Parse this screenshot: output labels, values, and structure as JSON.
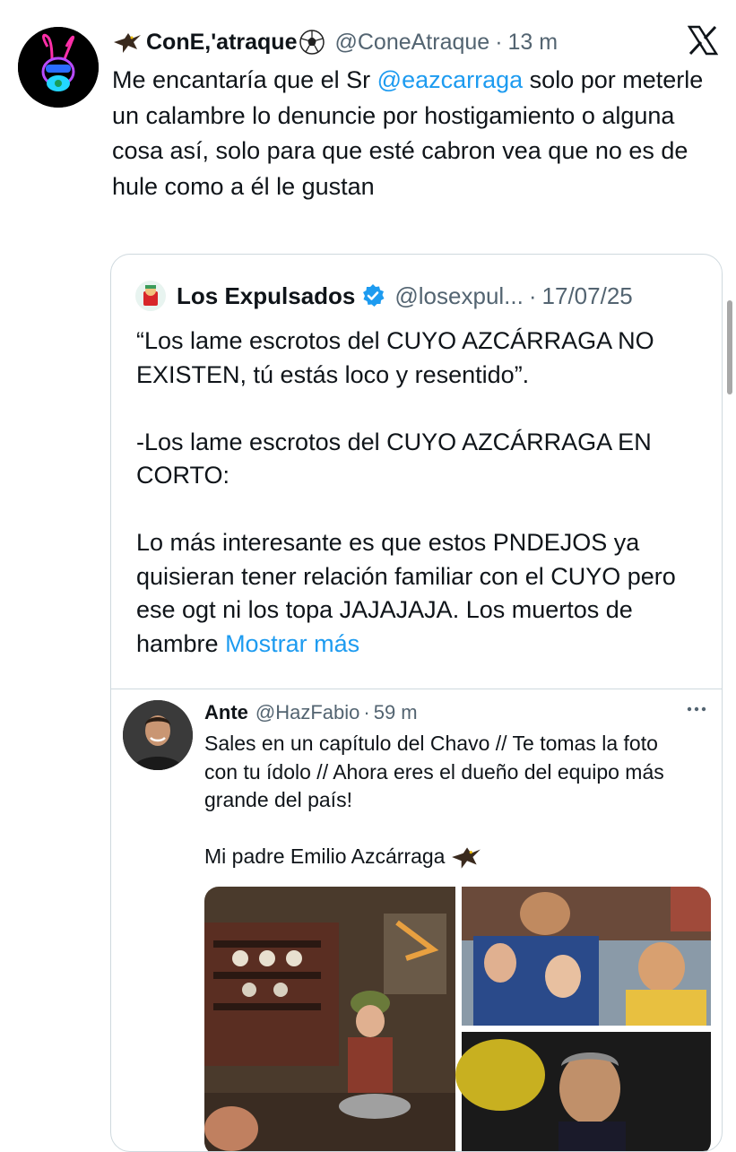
{
  "tweet": {
    "author_name": "ConE,'atraque",
    "handle": "@ConeAtraque",
    "separator": "·",
    "time": "13 m",
    "text_before_mention": "Me encantaría que el Sr ",
    "mention": "@eazcarraga",
    "text_after_mention": " solo por meterle un calambre lo denuncie por hostigamiento o alguna cosa así, solo para que esté cabron vea que no es de hule como a él le gustan"
  },
  "quoted": {
    "author_name": "Los Expulsados",
    "handle": "@losexpul...",
    "separator": "·",
    "date": "17/07/25",
    "paragraph_1": "“Los lame escrotos del CUYO AZCÁRRAGA NO EXISTEN, tú estás loco y resentido”.",
    "paragraph_2": "-Los lame escrotos del CUYO AZCÁRRAGA EN CORTO:",
    "paragraph_3": "Lo más interesante es que estos PNDEJOS ya quisieran tener relación familiar con el CUYO pero ese ogt ni los topa JAJAJAJA. Los muertos de hambre",
    "show_more": "Mostrar más"
  },
  "inner": {
    "author_name": "Ante",
    "handle": "@HazFabio",
    "separator": "·",
    "time": "59 m",
    "paragraph_1": "Sales en un capítulo del Chavo // Te tomas la foto con tu ídolo // Ahora eres el dueño del equipo más grande del país!",
    "paragraph_2": "Mi padre Emilio Azcárraga"
  },
  "icons": {
    "eagle": "eagle-emoji-icon",
    "soccer": "soccer-ball-emoji-icon",
    "x_logo": "x-logo-icon",
    "verified": "verified-badge-icon",
    "more": "more-options-icon"
  },
  "colors": {
    "link": "#1d9bf0",
    "muted": "#536471",
    "border": "#cfd9de"
  }
}
